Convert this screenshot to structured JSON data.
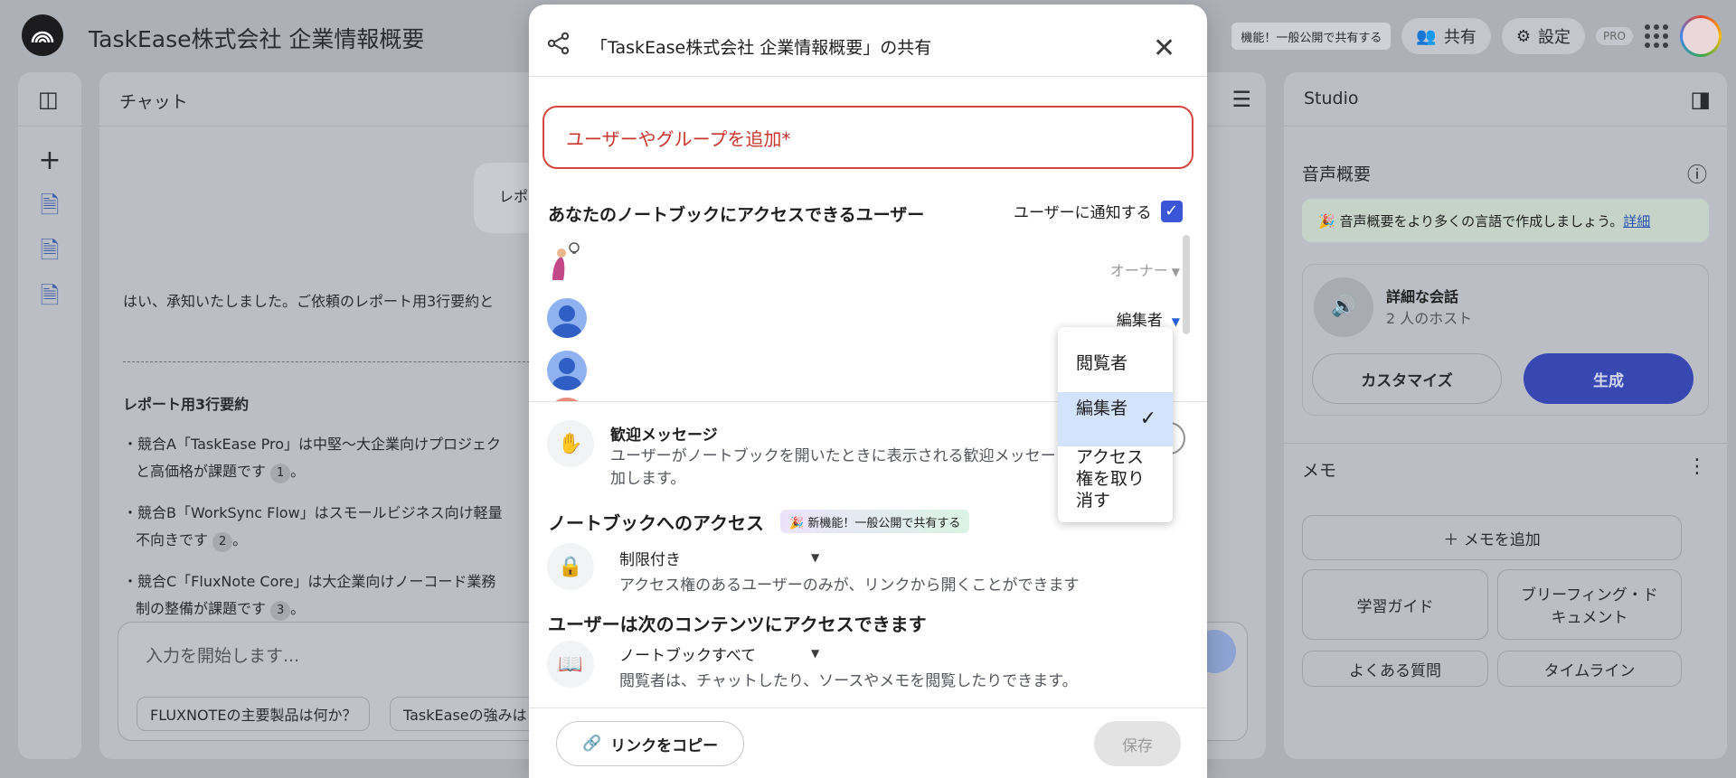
{
  "app": {
    "title": "TaskEase株式会社 企業情報概要",
    "new_feature_pill": "機能！一般公開で共有する",
    "share_label": "共有",
    "settings_label": "設定",
    "pro_badge": "PRO"
  },
  "chat": {
    "header": "チャット",
    "bubble_text": "レポ",
    "reply_intro": "はい、承知いたしました。ご依頼のレポート用3行要約と",
    "summary_heading": "レポート用3行要約",
    "bullets": [
      {
        "line1": "・競合A「TaskEase Pro」は中堅〜大企業向けプロジェク",
        "line2": "と高価格が課題です",
        "cite": "1"
      },
      {
        "line1": "・競合B「WorkSync Flow」はスモールビジネス向け軽量",
        "line2": "不向きです",
        "cite": "2"
      },
      {
        "line1": "・競合C「FluxNote Core」は大企業向けノーコード業務",
        "line2": "制の整備が課題です",
        "cite": "3"
      }
    ],
    "input_placeholder": "入力を開始します...",
    "suggestions": [
      "FLUXNOTEの主要製品は何か？",
      "TaskEaseの強みは"
    ]
  },
  "studio": {
    "header": "Studio",
    "audio_title": "音声概要",
    "lang_banner": "🎉 音声概要をより多くの言語で作成しましょう。",
    "lang_link": "詳細",
    "conv_title": "詳細な会話",
    "conv_sub": "2 人のホスト",
    "customize": "カスタマイズ",
    "generate": "生成",
    "memo_title": "メモ",
    "add_memo": "＋ メモを追加",
    "study_guide": "学習ガイド",
    "briefing": "ブリーフィング・ドキュメント",
    "faq": "よくある質問",
    "timeline": "タイムライン"
  },
  "modal": {
    "title": "「TaskEase株式会社 企業情報概要」の共有",
    "add_placeholder": "ユーザーやグループを追加*",
    "access_heading": "あなたのノートブックにアクセスできるユーザー",
    "notify_label": "ユーザーに通知する",
    "users": [
      {
        "role": "オーナー"
      },
      {
        "role": "編集者"
      },
      {
        "role": ""
      }
    ],
    "welcome_title": "歓迎メッセージ",
    "welcome_desc_1": "ユーザーがノートブックを開いたときに表示される歓迎メッセー",
    "welcome_desc_2": "加します。",
    "nb_access_heading": "ノートブックへのアクセス",
    "new_badge": "🎉 新機能！一般公開で共有する",
    "restriction_label": "制限付き",
    "restriction_desc": "アクセス権のあるユーザーのみが、リンクから開くことができます",
    "content_heading": "ユーザーは次のコンテンツにアクセスできます",
    "content_label": "ノートブックすべて",
    "content_desc": "閲覧者は、チャットしたり、ソースやメモを閲覧したりできます。",
    "copy_link": "リンクをコピー",
    "save": "保存"
  },
  "role_menu": {
    "viewer": "閲覧者",
    "editor": "編集者",
    "remove": "アクセス権を取り消す",
    "selected": "editor"
  }
}
